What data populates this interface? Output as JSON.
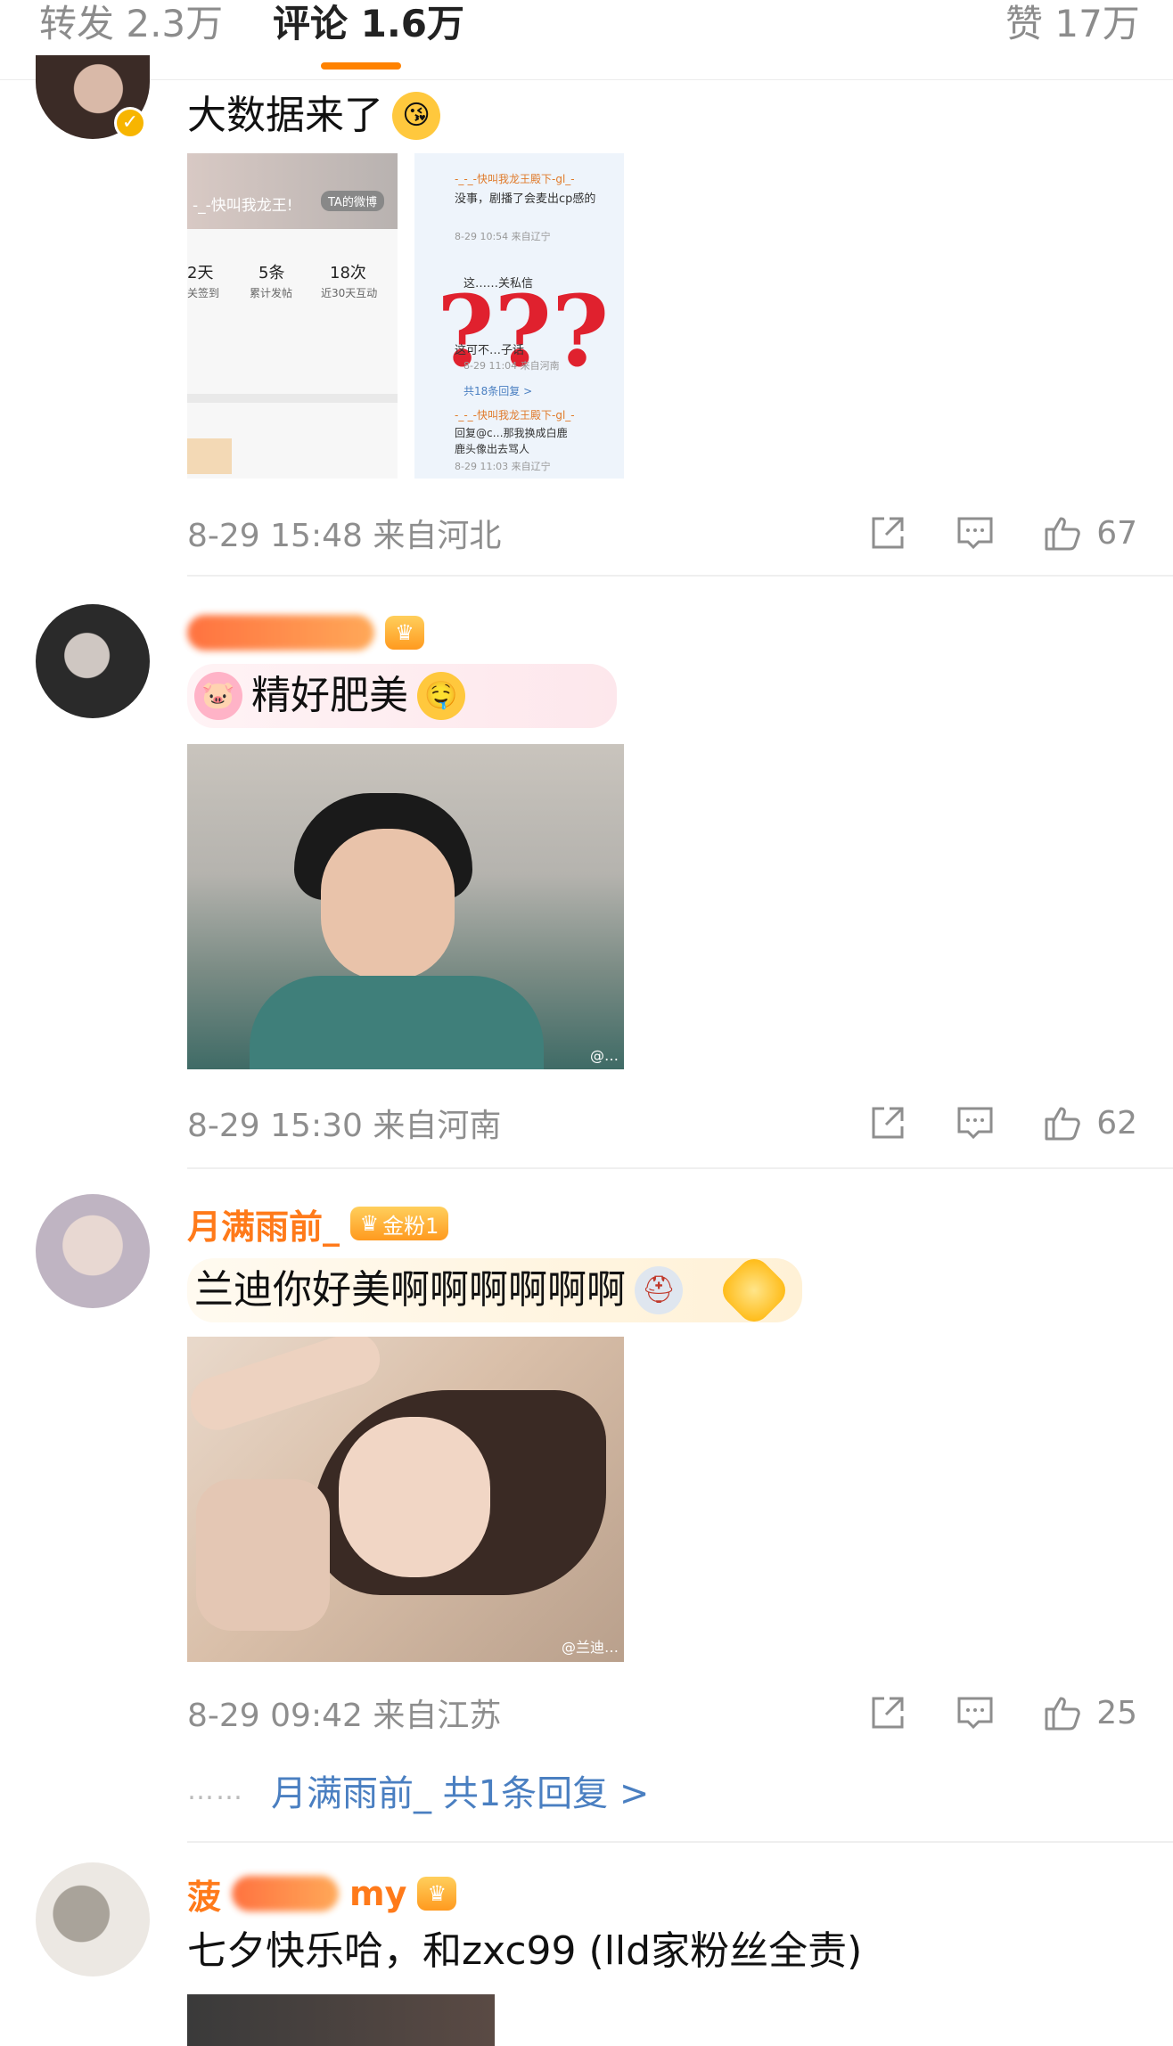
{
  "tabs": [
    {
      "label": "转发 2.3万"
    },
    {
      "label": "评论 1.6万"
    },
    {
      "label": "赞 17万"
    }
  ],
  "colors": {
    "accent": "#ff8200",
    "username": "#ff7a1a",
    "link": "#4a7fc1",
    "meta": "#8e8e8e"
  },
  "comments": [
    {
      "text": "大数据来了",
      "emoji": "face-with-kiss-emoji",
      "time": "8-29 15:48 来自河北",
      "likes": "67",
      "image_texts": {
        "left_title": "-_-快叫我龙王!",
        "left_btn": "TA的微博",
        "stat1_num": "2天",
        "stat1_label": "关签到",
        "stat2_num": "5条",
        "stat2_label": "累计发帖",
        "stat3_num": "18次",
        "stat3_label": "近30天互动",
        "r_user1": "-_-_-快叫我龙王殿下-gl_-",
        "r_msg1": "没事，剧播了会麦出cp感的",
        "r_time1": "8-29 10:54 来自辽宁",
        "r_msg2": "这……关私信",
        "r_msg3": "这可不…子话",
        "r_time3": "8-29 11:04 来自河南",
        "r_replies": "共18条回复 >",
        "r_user2": "-_-_-快叫我龙王殿下-gl_-",
        "r_msg4": "回复@c…那我换成白鹿",
        "r_msg5": "鹿头像出去骂人",
        "r_time4": "8-29 11:03 来自辽宁",
        "qmarks": "???"
      }
    },
    {
      "username": "",
      "text": "精好肥美",
      "time": "8-29 15:30 来自河南",
      "likes": "62",
      "image_watermark": "@…"
    },
    {
      "username": "月满雨前_",
      "fan_badge": "金粉1",
      "text": "兰迪你好美啊啊啊啊啊啊",
      "time": "8-29 09:42 来自江苏",
      "likes": "25",
      "image_watermark": "@兰迪…",
      "reply_dots": "……",
      "reply_link": "月满雨前_ 共1条回复 >"
    },
    {
      "username_start": "菠",
      "username_end": "my",
      "text": "七夕快乐哈，和zxc99 (lld家粉丝全责)"
    }
  ]
}
